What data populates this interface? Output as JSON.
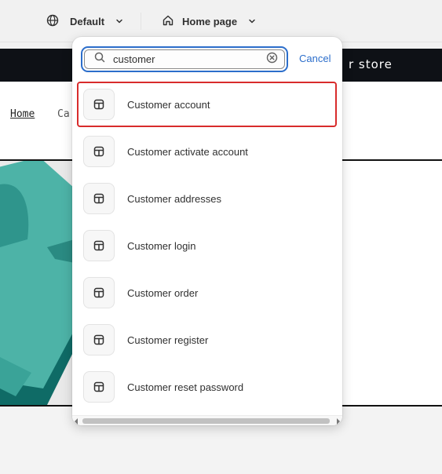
{
  "topbar": {
    "language_label": "Default",
    "page_label": "Home page"
  },
  "preview": {
    "store_text": "r store",
    "breadcrumb_home": "Home",
    "breadcrumb_partial": "Ca"
  },
  "search": {
    "value": "customer",
    "cancel_label": "Cancel"
  },
  "results": [
    {
      "label": "Customer account",
      "icon": "template-icon",
      "selected": true
    },
    {
      "label": "Customer activate account",
      "icon": "template-icon",
      "selected": false
    },
    {
      "label": "Customer addresses",
      "icon": "template-icon",
      "selected": false
    },
    {
      "label": "Customer login",
      "icon": "template-icon",
      "selected": false
    },
    {
      "label": "Customer order",
      "icon": "template-icon",
      "selected": false
    },
    {
      "label": "Customer register",
      "icon": "template-icon",
      "selected": false
    },
    {
      "label": "Customer reset password",
      "icon": "template-icon",
      "selected": false
    }
  ],
  "colors": {
    "accent": "#2c6ecb",
    "selection_outline": "#d82c2c",
    "store_bar": "#0e1116",
    "hero_teal": "#4db3a7"
  }
}
